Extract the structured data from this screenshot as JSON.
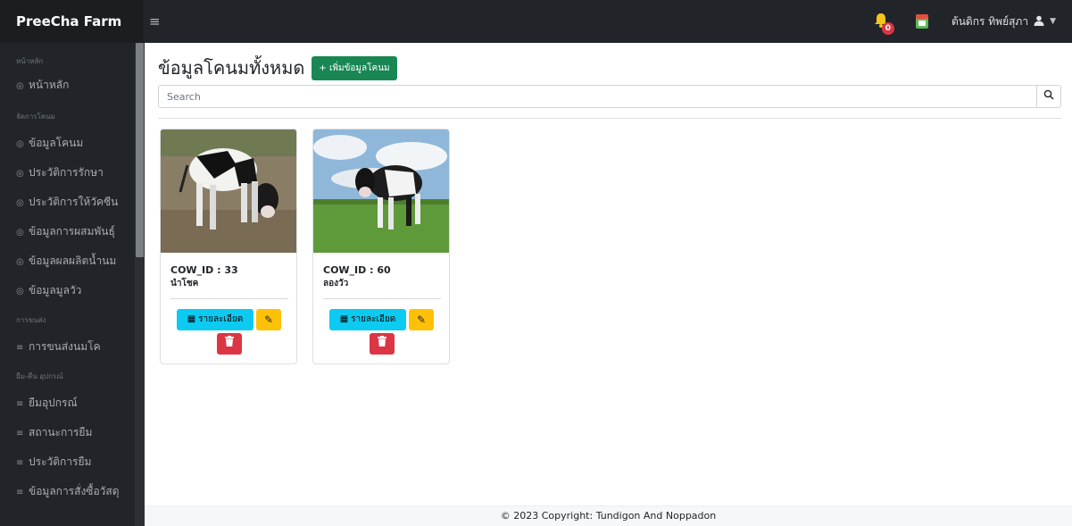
{
  "app": {
    "brand": "PreeCha Farm",
    "menu_icon": "hamburger-icon"
  },
  "topbar": {
    "notification_count": "0",
    "user_name": "ต้นดิกร ทิพย์สุภา",
    "user_icon": "user-icon",
    "caret": "▼"
  },
  "sidebar": {
    "sections": [
      {
        "heading": "หน้าหลัก",
        "items": [
          {
            "label": "หน้าหลัก",
            "icon": "◎"
          }
        ]
      },
      {
        "heading": "จัดการโคนม",
        "items": [
          {
            "label": "ข้อมูลโคนม",
            "icon": "◎"
          },
          {
            "label": "ประวัติการรักษา",
            "icon": "◎"
          },
          {
            "label": "ประวัติการให้วัคซีน",
            "icon": "◎"
          },
          {
            "label": "ข้อมูลการผสมพันธุ์",
            "icon": "◎"
          },
          {
            "label": "ข้อมูลผลผลิตน้ำนม",
            "icon": "◎"
          },
          {
            "label": "ข้อมูลมูลวัว",
            "icon": "◎"
          }
        ]
      },
      {
        "heading": "การขนส่ง",
        "items": [
          {
            "label": "การขนส่งนมโค",
            "icon": "≡"
          }
        ]
      },
      {
        "heading": "ยืม-คืน อุปกรณ์",
        "items": [
          {
            "label": "ยืมอุปกรณ์",
            "icon": "≡"
          },
          {
            "label": "สถานะการยืม",
            "icon": "≡"
          },
          {
            "label": "ประวัติการยืม",
            "icon": "≡"
          },
          {
            "label": "ข้อมูลการสั่งซื้อวัสดุ",
            "icon": "≡"
          }
        ]
      }
    ]
  },
  "main": {
    "title": "ข้อมูลโคนมทั้งหมด",
    "add_button": "+ เพิ่มข้อมูลโคนม",
    "search_placeholder": "Search",
    "search_icon": "search-icon",
    "cards": [
      {
        "id_label": "COW_ID : 33",
        "name": "นำโชค",
        "detail_label": "รายละเอียด"
      },
      {
        "id_label": "COW_ID : 60",
        "name": "ลองวัว",
        "detail_label": "รายละเอียด"
      }
    ]
  },
  "footer": {
    "text": "© 2023 Copyright: Tundigon And Noppadon"
  },
  "colors": {
    "sidebar_bg": "#212529",
    "add_green": "#198754",
    "info_cyan": "#0dcaf0",
    "warning_yellow": "#ffc107",
    "danger_red": "#dc3545"
  }
}
